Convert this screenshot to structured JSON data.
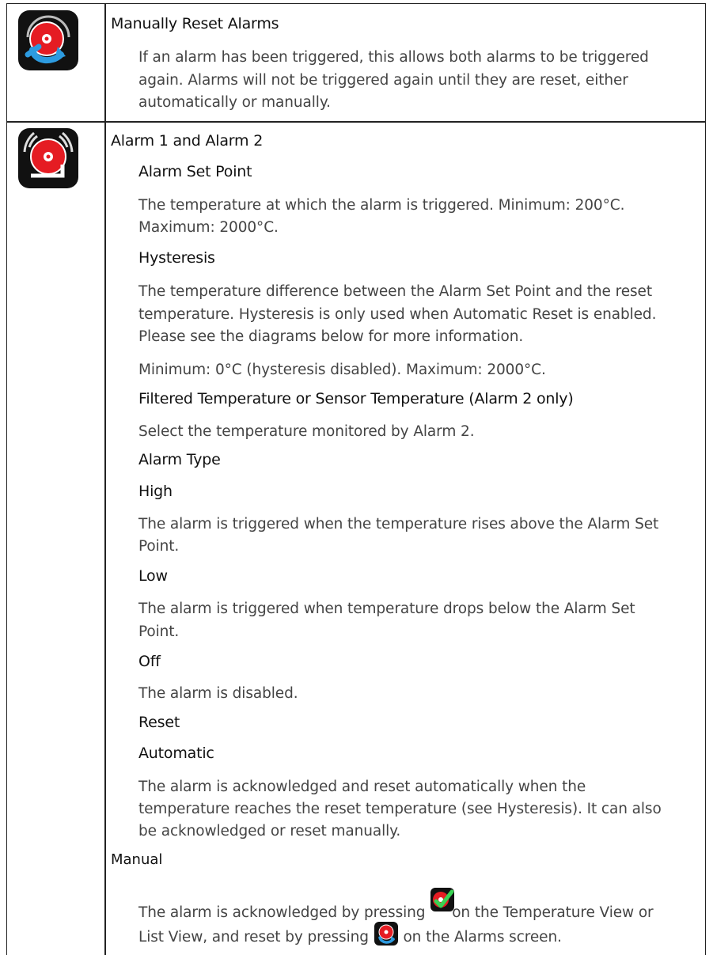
{
  "row1": {
    "icon": "manual-reset-icon",
    "title": "Manually Reset Alarms",
    "desc_lines": [
      "If an alarm has been triggered, this allows both alarms to be triggered",
      "again. Alarms will not be triggered again until they are reset, either",
      "automatically or manually."
    ]
  },
  "row2": {
    "icon": "alarm-bell-icon",
    "title": "Alarm 1 and Alarm 2",
    "setpoint": {
      "heading": "Alarm Set Point",
      "lines": [
        "The temperature at which the alarm is triggered. Minimum: 200°C.",
        "Maximum: 2000°C."
      ]
    },
    "hysteresis": {
      "heading": "Hysteresis",
      "lines": [
        "The temperature difference between the Alarm Set Point and the reset",
        "temperature. Hysteresis is only used when Automatic Reset is enabled.",
        "Please see the diagrams below for more information."
      ],
      "range": "Minimum: 0°C (hysteresis disabled). Maximum: 2000°C."
    },
    "filtered": {
      "heading": "Filtered Temperature or Sensor Temperature (Alarm 2 only)",
      "text": "Select the temperature monitored by Alarm 2."
    },
    "alarm_type": {
      "heading": "Alarm Type",
      "high": {
        "heading": "High",
        "lines": [
          "The alarm is triggered when the temperature rises above the Alarm Set",
          "Point."
        ]
      },
      "low": {
        "heading": "Low",
        "lines": [
          "The alarm is triggered when temperature drops below the Alarm Set",
          "Point."
        ]
      },
      "off": {
        "heading": "Off",
        "text": "The alarm is disabled."
      }
    },
    "reset": {
      "heading": "Reset",
      "automatic": {
        "heading": "Automatic",
        "lines": [
          "The alarm is acknowledged and reset automatically when the",
          "temperature reaches the reset temperature (see Hysteresis). It can also",
          "be acknowledged or reset manually."
        ]
      },
      "manual": {
        "heading": "Manual",
        "line1_before": "The alarm is acknowledged by pressing ",
        "line1_after": "on the Temperature View or",
        "line2_before": "List View, and reset by pressing ",
        "line2_after": " on the Alarms screen.",
        "ack_icon": "acknowledge-icon",
        "reset_icon": "manual-reset-icon"
      }
    }
  }
}
